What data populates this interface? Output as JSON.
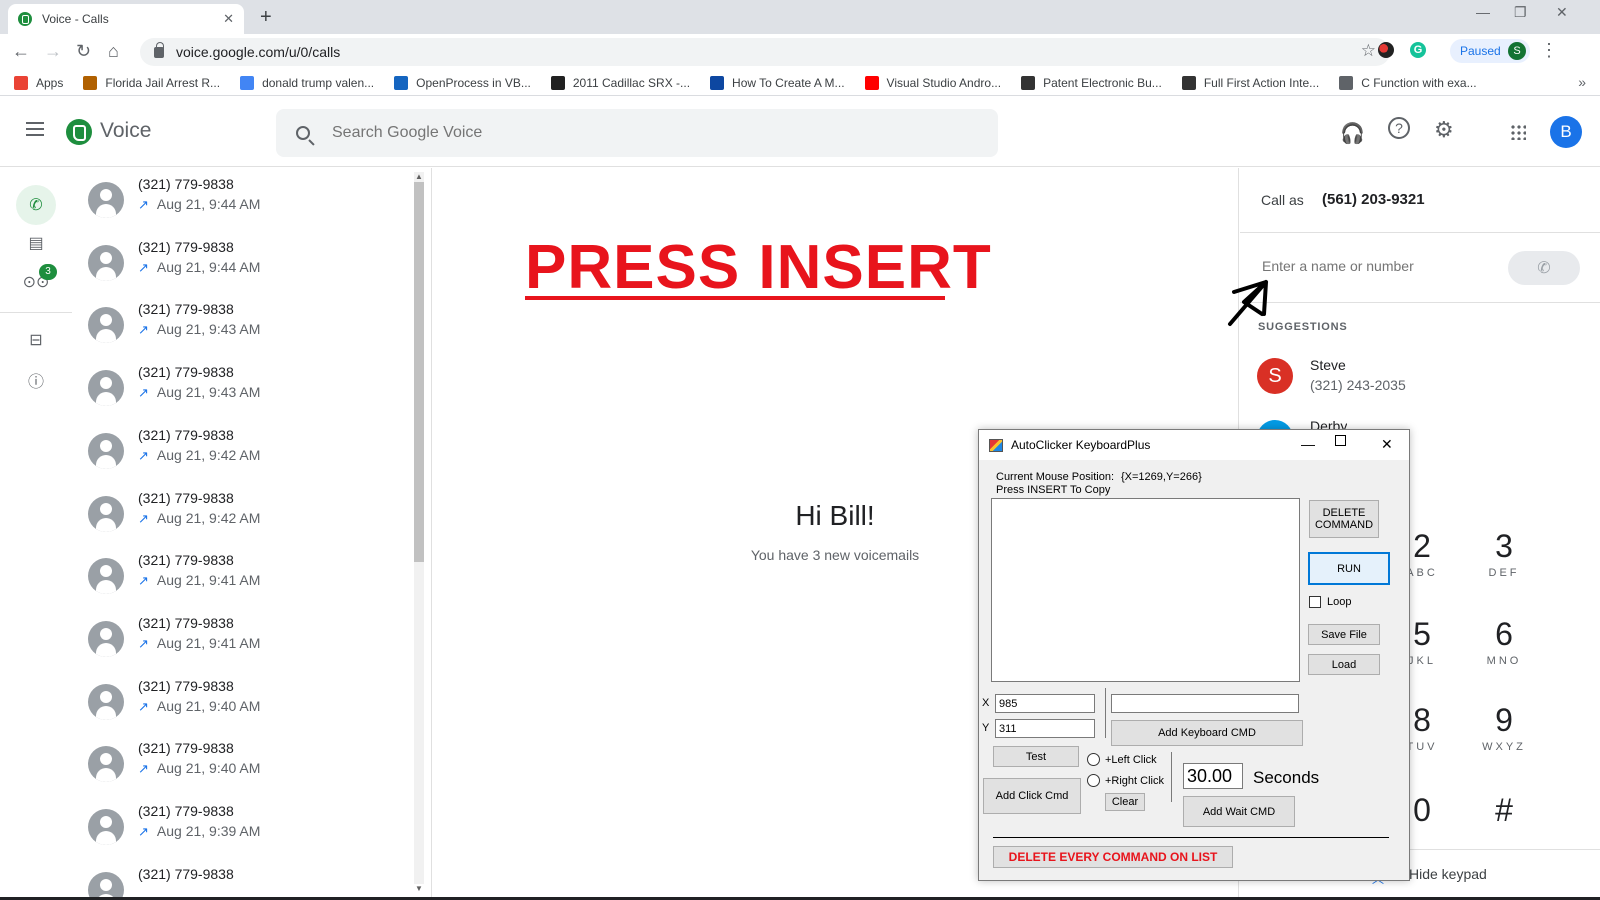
{
  "browser": {
    "tab_title": "Voice - Calls",
    "url": "voice.google.com/u/0/calls",
    "profile_status": "Paused",
    "profile_initial": "S",
    "bookmarks": [
      {
        "label": "Apps",
        "icon": "apps-grid-icon",
        "color": "#ea4335"
      },
      {
        "label": "Florida Jail Arrest R...",
        "icon": "jail-icon",
        "color": "#b06000"
      },
      {
        "label": "donald trump valen...",
        "icon": "google-g-icon",
        "color": "#4285f4"
      },
      {
        "label": "OpenProcess in VB...",
        "icon": "x-logo-icon",
        "color": "#1565c0"
      },
      {
        "label": "2011 Cadillac SRX -...",
        "icon": "c-logo-icon",
        "color": "#212121"
      },
      {
        "label": "How To Create A M...",
        "icon": "b-logo-icon",
        "color": "#0d47a1"
      },
      {
        "label": "Visual Studio Andro...",
        "icon": "youtube-icon",
        "color": "#ff0000"
      },
      {
        "label": "Patent Electronic Bu...",
        "icon": "bulb-icon",
        "color": "#333333"
      },
      {
        "label": "Full First Action Inte...",
        "icon": "bulb-icon",
        "color": "#333333"
      },
      {
        "label": "C Function with exa...",
        "icon": "globe-icon",
        "color": "#5f6368"
      }
    ],
    "bookmarks_more": "»"
  },
  "voice": {
    "app_name": "Voice",
    "search_placeholder": "Search Google Voice",
    "user_initial": "B",
    "voicemail_badge": "3",
    "accent": "#1e8e3e"
  },
  "calls": [
    {
      "number": "(321) 779-9838",
      "time": "Aug 21, 9:44 AM"
    },
    {
      "number": "(321) 779-9838",
      "time": "Aug 21, 9:44 AM"
    },
    {
      "number": "(321) 779-9838",
      "time": "Aug 21, 9:43 AM"
    },
    {
      "number": "(321) 779-9838",
      "time": "Aug 21, 9:43 AM"
    },
    {
      "number": "(321) 779-9838",
      "time": "Aug 21, 9:42 AM"
    },
    {
      "number": "(321) 779-9838",
      "time": "Aug 21, 9:42 AM"
    },
    {
      "number": "(321) 779-9838",
      "time": "Aug 21, 9:41 AM"
    },
    {
      "number": "(321) 779-9838",
      "time": "Aug 21, 9:41 AM"
    },
    {
      "number": "(321) 779-9838",
      "time": "Aug 21, 9:40 AM"
    },
    {
      "number": "(321) 779-9838",
      "time": "Aug 21, 9:40 AM"
    },
    {
      "number": "(321) 779-9838",
      "time": "Aug 21, 9:39 AM"
    },
    {
      "number": "(321) 779-9838",
      "time": ""
    }
  ],
  "main": {
    "annotation": "PRESS INSERT",
    "greeting": "Hi Bill!",
    "voicemail_text": "You have 3 new voicemails"
  },
  "dialer": {
    "call_as_label": "Call as",
    "call_as_number": "(561) 203-9321",
    "input_placeholder": "Enter a name or number",
    "suggestions_label": "SUGGESTIONS",
    "suggestions": [
      {
        "initial": "S",
        "name": "Steve",
        "number": "(321) 243-2035"
      },
      {
        "name": "Derby"
      }
    ],
    "keys": [
      {
        "digit": "2",
        "letters": "ABC"
      },
      {
        "digit": "3",
        "letters": "DEF"
      },
      {
        "digit": "5",
        "letters": "JKL"
      },
      {
        "digit": "6",
        "letters": "MNO"
      },
      {
        "digit": "8",
        "letters": "TUV"
      },
      {
        "digit": "9",
        "letters": "WXYZ"
      },
      {
        "digit": "0",
        "letters": ""
      },
      {
        "digit": "#",
        "letters": ""
      }
    ],
    "hide_keypad": "Hide keypad"
  },
  "autoclicker": {
    "title": "AutoClicker KeyboardPlus",
    "mouse_label": "Current Mouse Position:",
    "mouse_value": "{X=1269,Y=266}",
    "insert_hint": "Press INSERT To Copy",
    "delete_command": "DELETE COMMAND",
    "run": "RUN",
    "loop": "Loop",
    "save_file": "Save File",
    "load": "Load",
    "x_label": "X",
    "y_label": "Y",
    "x_value": "985",
    "y_value": "311",
    "keyboard_value": "",
    "add_keyboard_cmd": "Add Keyboard CMD",
    "test": "Test",
    "left_click": "+Left Click",
    "right_click": "+Right Click",
    "seconds_value": "30.00",
    "seconds_label": "Seconds",
    "add_click_cmd": "Add Click Cmd",
    "clear": "Clear",
    "add_wait_cmd": "Add Wait CMD",
    "delete_all": "DELETE EVERY COMMAND ON LIST"
  }
}
